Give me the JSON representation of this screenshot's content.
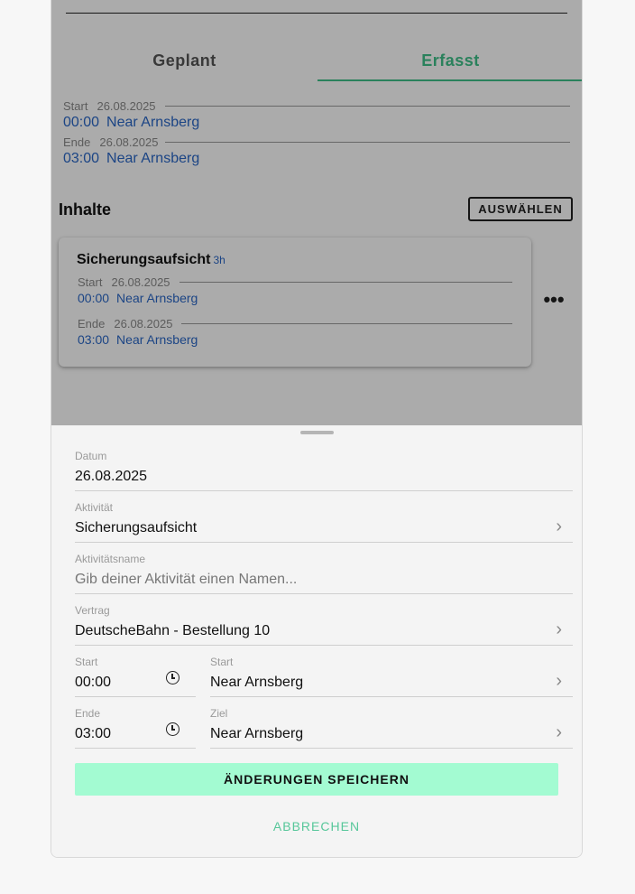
{
  "tabs": [
    {
      "label": "Geplant",
      "active": false
    },
    {
      "label": "Erfasst",
      "active": true
    }
  ],
  "times": {
    "start": {
      "label": "Start",
      "date": "26.08.2025",
      "time": "00:00",
      "location": "Near Arnsberg"
    },
    "end": {
      "label": "Ende",
      "date": "26.08.2025",
      "time": "03:00",
      "location": "Near Arnsberg"
    }
  },
  "contents": {
    "title": "Inhalte",
    "select_label": "AUSWÄHLEN",
    "card": {
      "title": "Sicherungsaufsicht",
      "duration": "3h",
      "start": {
        "label": "Start",
        "date": "26.08.2025",
        "time": "00:00",
        "location": "Near Arnsberg"
      },
      "end": {
        "label": "Ende",
        "date": "26.08.2025",
        "time": "03:00",
        "location": "Near Arnsberg"
      },
      "more_icon": "•••"
    }
  },
  "form": {
    "date": {
      "label": "Datum",
      "value": "26.08.2025"
    },
    "activity": {
      "label": "Aktivität",
      "value": "Sicherungsaufsicht"
    },
    "activity_name": {
      "label": "Aktivitätsname",
      "placeholder": "Gib deiner Aktivität einen Namen..."
    },
    "contract": {
      "label": "Vertrag",
      "value": "DeutscheBahn - Bestellung 10"
    },
    "start_time": {
      "label": "Start",
      "value": "00:00"
    },
    "start_location": {
      "label": "Start",
      "value": "Near Arnsberg"
    },
    "end_time": {
      "label": "Ende",
      "value": "03:00"
    },
    "end_location": {
      "label": "Ziel",
      "value": "Near Arnsberg"
    },
    "chevron_icon": "chevron-right",
    "clock_icon": "clock",
    "save_label": "ÄNDERUNGEN SPEICHERN",
    "cancel_label": "ABBRECHEN"
  },
  "colors": {
    "accent": "#3fc08a",
    "link": "#2a67c7",
    "save_button": "#a3fbd2",
    "cancel_text": "#57c79a"
  }
}
